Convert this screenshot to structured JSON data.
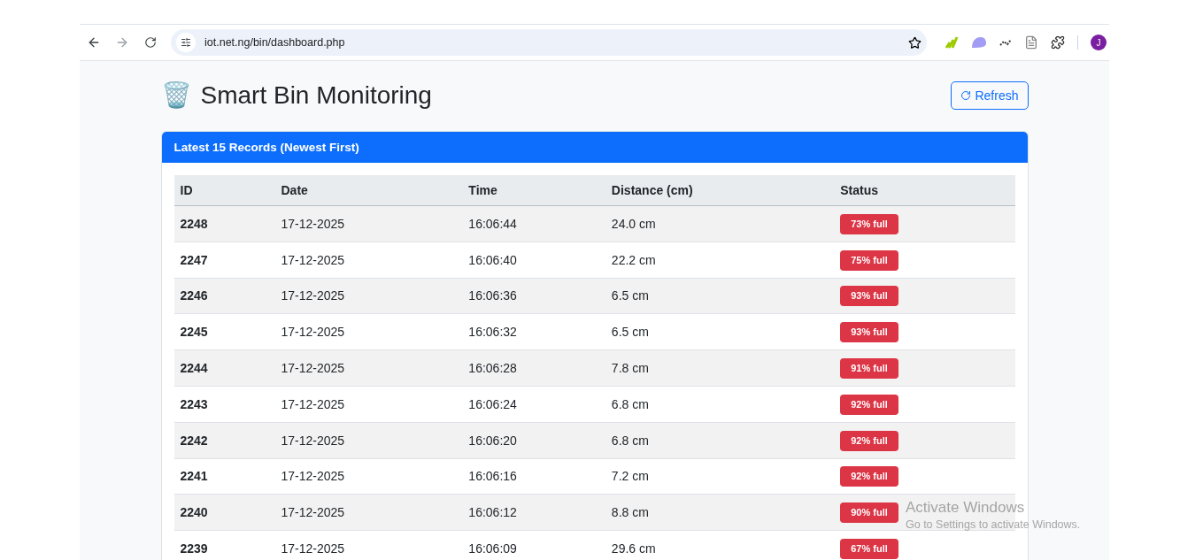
{
  "browser": {
    "url": "iot.net.ng/bin/dashboard.php",
    "profile_initial": "J"
  },
  "header": {
    "icon": "🗑️",
    "title": "Smart Bin Monitoring",
    "refresh_button": "Refresh"
  },
  "card": {
    "title": "Latest 15 Records (Newest First)"
  },
  "table": {
    "columns": [
      "ID",
      "Date",
      "Time",
      "Distance (cm)",
      "Status"
    ],
    "rows": [
      {
        "id": "2248",
        "date": "17-12-2025",
        "time": "16:06:44",
        "distance": "24.0 cm",
        "status": "73% full"
      },
      {
        "id": "2247",
        "date": "17-12-2025",
        "time": "16:06:40",
        "distance": "22.2 cm",
        "status": "75% full"
      },
      {
        "id": "2246",
        "date": "17-12-2025",
        "time": "16:06:36",
        "distance": "6.5 cm",
        "status": "93% full"
      },
      {
        "id": "2245",
        "date": "17-12-2025",
        "time": "16:06:32",
        "distance": "6.5 cm",
        "status": "93% full"
      },
      {
        "id": "2244",
        "date": "17-12-2025",
        "time": "16:06:28",
        "distance": "7.8 cm",
        "status": "91% full"
      },
      {
        "id": "2243",
        "date": "17-12-2025",
        "time": "16:06:24",
        "distance": "6.8 cm",
        "status": "92% full"
      },
      {
        "id": "2242",
        "date": "17-12-2025",
        "time": "16:06:20",
        "distance": "6.8 cm",
        "status": "92% full"
      },
      {
        "id": "2241",
        "date": "17-12-2025",
        "time": "16:06:16",
        "distance": "7.2 cm",
        "status": "92% full"
      },
      {
        "id": "2240",
        "date": "17-12-2025",
        "time": "16:06:12",
        "distance": "8.8 cm",
        "status": "90% full"
      },
      {
        "id": "2239",
        "date": "17-12-2025",
        "time": "16:06:09",
        "distance": "29.6 cm",
        "status": "67% full"
      }
    ]
  },
  "os_overlay": {
    "title": "Activate Windows",
    "subtitle": "Go to Settings to activate Windows."
  }
}
